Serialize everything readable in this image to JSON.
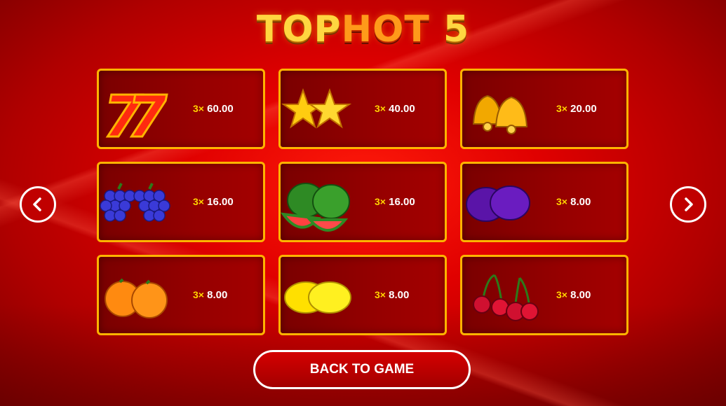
{
  "title": {
    "part1": "TOP",
    "part2": "HOT",
    "part3": "5"
  },
  "paytable": [
    {
      "symbol": "lucky-seven",
      "multiplier": "3×",
      "payout": "60.00"
    },
    {
      "symbol": "star",
      "multiplier": "3×",
      "payout": "40.00"
    },
    {
      "symbol": "bell",
      "multiplier": "3×",
      "payout": "20.00"
    },
    {
      "symbol": "grapes",
      "multiplier": "3×",
      "payout": "16.00"
    },
    {
      "symbol": "watermelon",
      "multiplier": "3×",
      "payout": "16.00"
    },
    {
      "symbol": "plum",
      "multiplier": "3×",
      "payout": "8.00"
    },
    {
      "symbol": "orange",
      "multiplier": "3×",
      "payout": "8.00"
    },
    {
      "symbol": "lemon",
      "multiplier": "3×",
      "payout": "8.00"
    },
    {
      "symbol": "cherry",
      "multiplier": "3×",
      "payout": "8.00"
    }
  ],
  "nav": {
    "prev_icon": "chevron-left-icon",
    "next_icon": "chevron-right-icon"
  },
  "back_button": {
    "label": "BACK TO GAME"
  },
  "colors": {
    "card_border": "#ffb400",
    "multiplier": "#ffd400",
    "background": "#d00000"
  }
}
